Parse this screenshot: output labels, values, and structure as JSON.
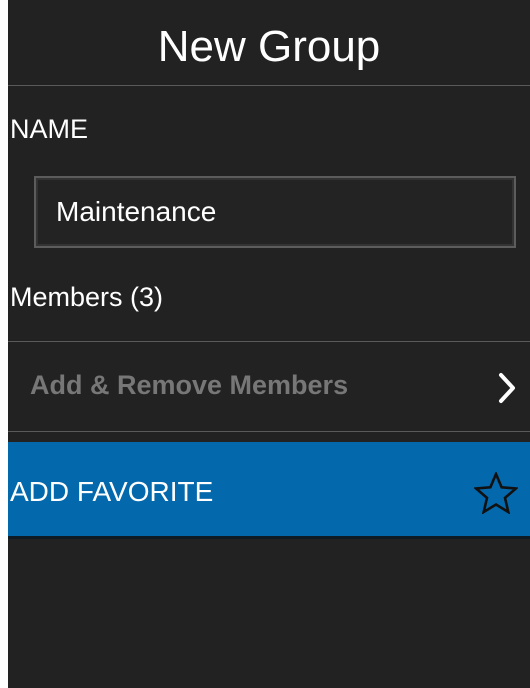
{
  "header": {
    "title": "New Group"
  },
  "name_section": {
    "label": "NAME",
    "value": "Maintenance"
  },
  "members": {
    "label": "Members (3)",
    "manage_label": "Add & Remove Members"
  },
  "favorite": {
    "label": "ADD FAVORITE"
  },
  "icons": {
    "chevron": "chevron-right-icon",
    "star": "star-outline-icon"
  },
  "colors": {
    "background": "#222222",
    "accent": "#0468ac",
    "text": "#ffffff",
    "disabled_text": "#777777",
    "divider": "#5a5a5a"
  }
}
